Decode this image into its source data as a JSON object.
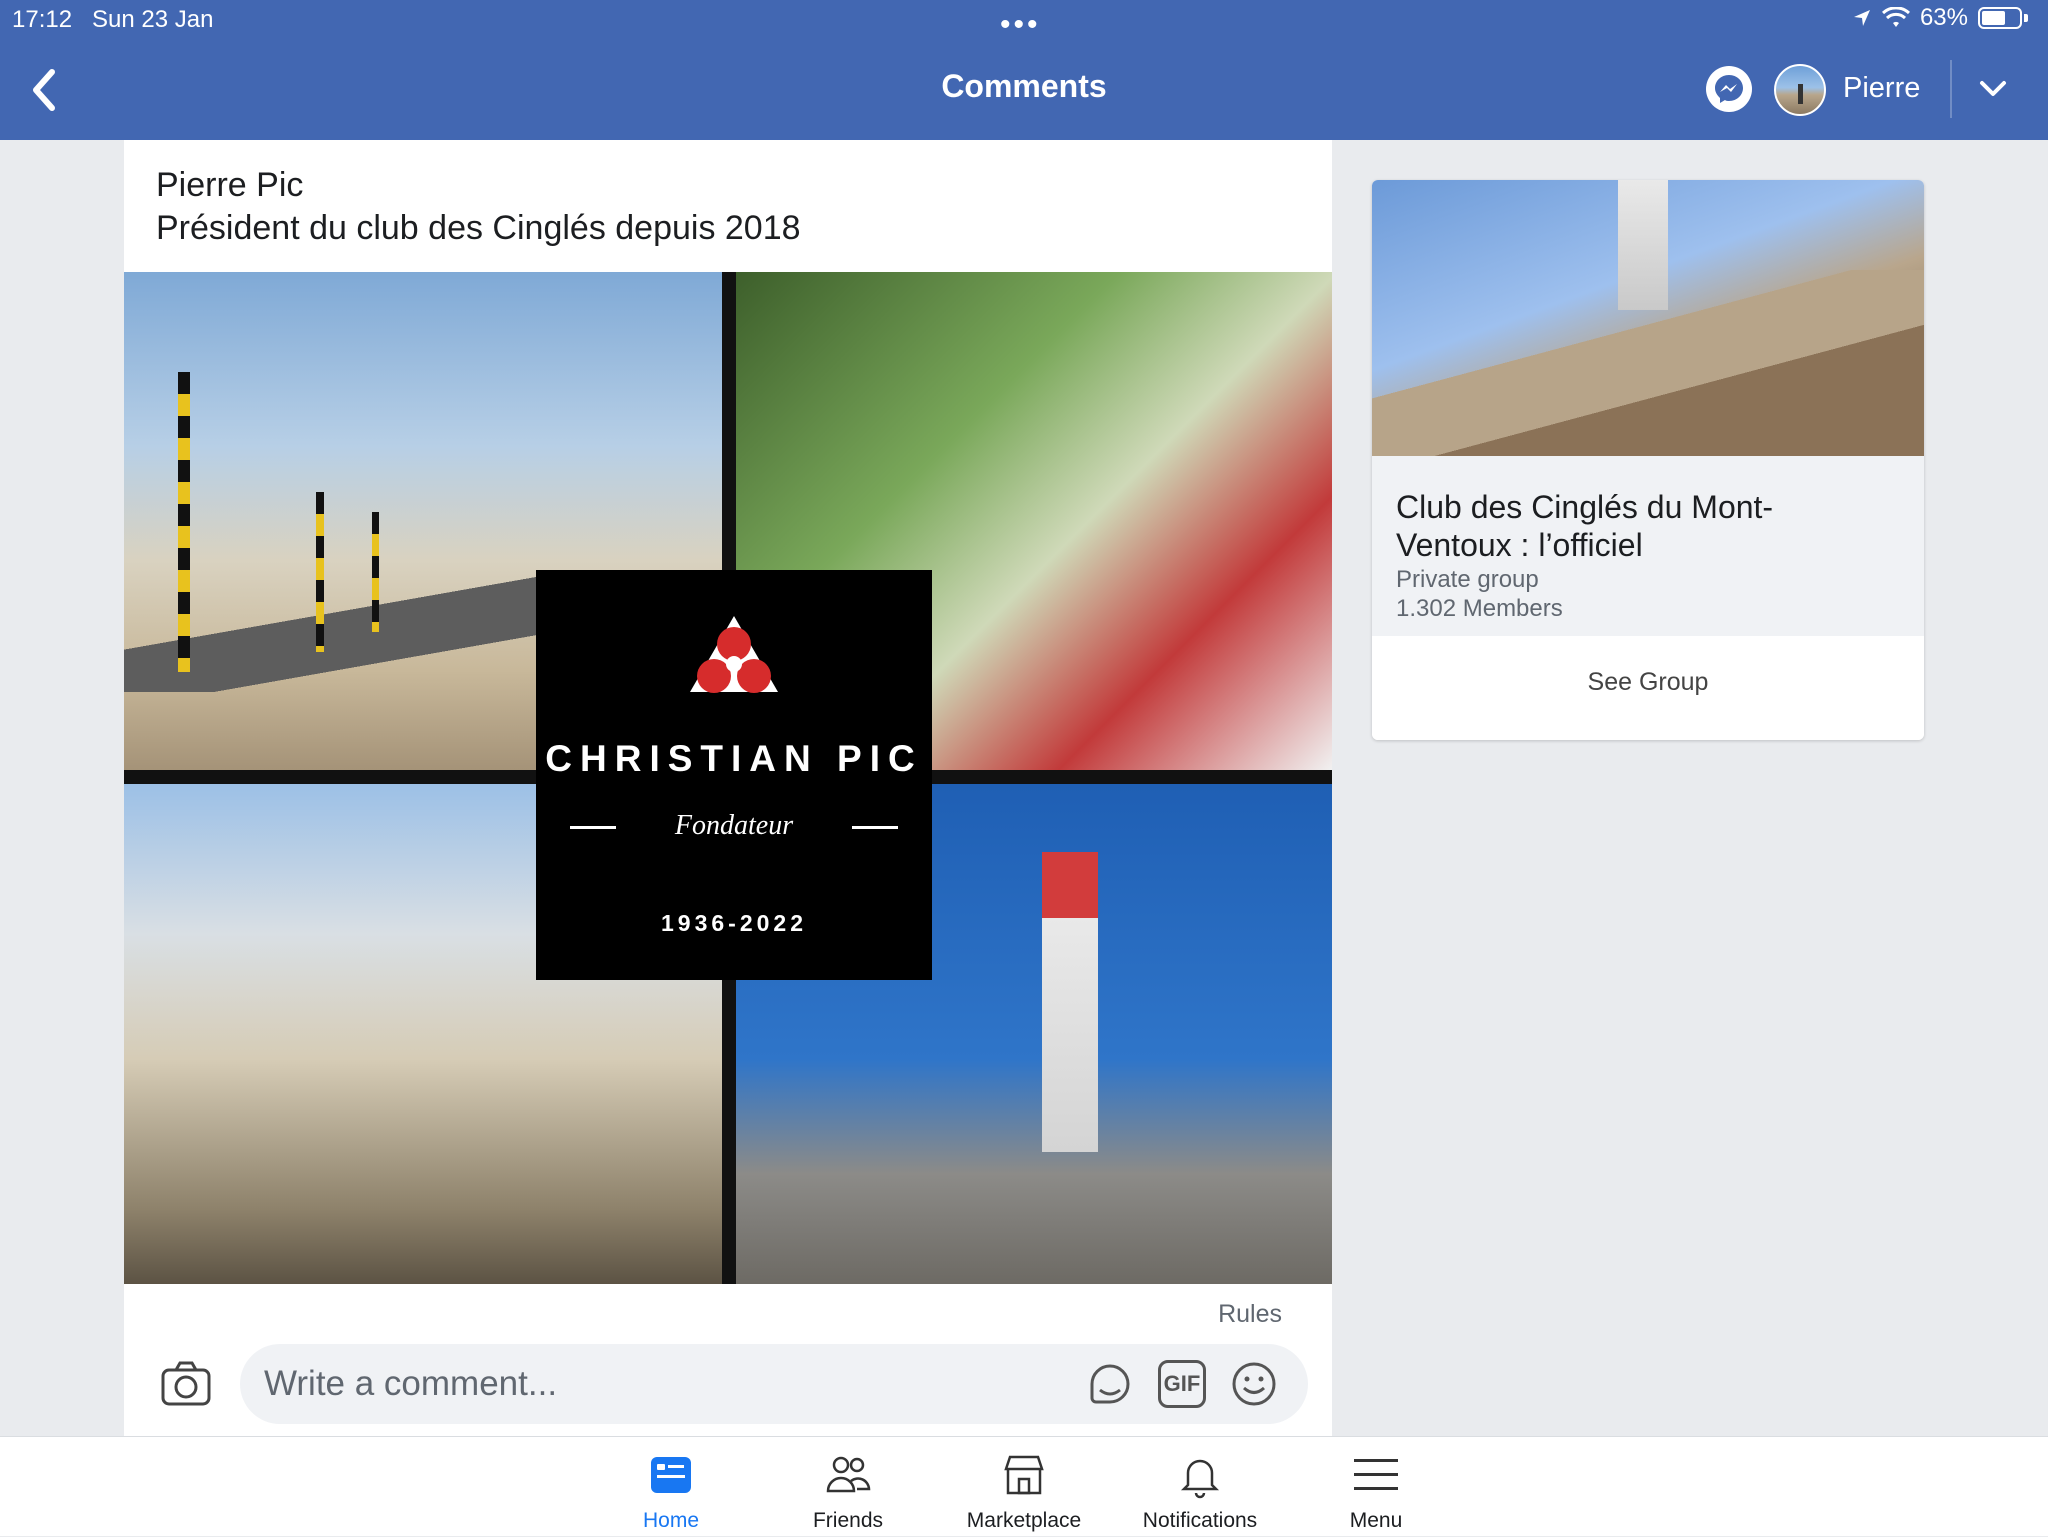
{
  "status_bar": {
    "time": "17:12",
    "date": "Sun 23 Jan",
    "battery": "63%",
    "battery_level": 0.63
  },
  "header": {
    "title": "Comments",
    "user_name": "Pierre"
  },
  "post": {
    "author": "Pierre Pic",
    "text": "Président du club des Cinglés depuis 2018",
    "image_overlay": {
      "name": "CHRISTIAN PIC",
      "role": "Fondateur",
      "years": "1936-2022"
    }
  },
  "comment": {
    "rules_label": "Rules",
    "placeholder": "Write a comment...",
    "value": "",
    "gif_label": "GIF"
  },
  "group": {
    "name": "Club des Cinglés du Mont-Ventoux : l’officiel",
    "privacy": "Private group",
    "members": "1.302 Members",
    "button_label": "See Group"
  },
  "tabs": [
    {
      "label": "Home",
      "icon": "home-feed-icon",
      "active": true
    },
    {
      "label": "Friends",
      "icon": "friends-icon",
      "active": false
    },
    {
      "label": "Marketplace",
      "icon": "marketplace-icon",
      "active": false
    },
    {
      "label": "Notifications",
      "icon": "bell-icon",
      "active": false
    },
    {
      "label": "Menu",
      "icon": "hamburger-icon",
      "active": false
    }
  ],
  "colors": {
    "brand": "#4267b2",
    "active_tab": "#1877f2",
    "background": "#e9ebee"
  }
}
